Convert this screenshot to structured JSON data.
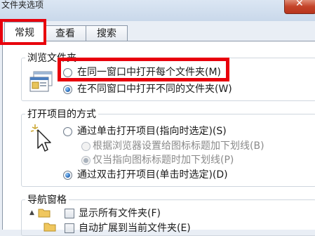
{
  "window": {
    "title": "文件夹选项",
    "close_symbol": "✕"
  },
  "tabs": [
    {
      "label": "常规",
      "active": true
    },
    {
      "label": "查看",
      "active": false
    },
    {
      "label": "搜索",
      "active": false
    }
  ],
  "browse_folders": {
    "title": "浏览文件夹",
    "options": [
      {
        "label": "在同一窗口中打开每个文件夹(M)",
        "checked": false
      },
      {
        "label": "在不同窗口中打开不同的文件夹(W)",
        "checked": true
      }
    ]
  },
  "open_items": {
    "title": "打开项目的方式",
    "options": [
      {
        "label": "通过单击打开项目(指向时选定)(S)",
        "checked": false,
        "disabled": false
      },
      {
        "label": "根据浏览器设置给图标标题加下划线(B)",
        "checked": false,
        "disabled": true
      },
      {
        "label": "仅当指向图标标题时加下划线(P)",
        "checked": true,
        "disabled": true
      },
      {
        "label": "通过双击打开项目(单击时选定)(D)",
        "checked": true,
        "disabled": false
      }
    ]
  },
  "navigation_pane": {
    "title": "导航窗格",
    "options": [
      {
        "label": "显示所有文件夹(F)",
        "checked": false
      },
      {
        "label": "自动扩展到当前文件夹(E)",
        "checked": false
      }
    ]
  },
  "colors": {
    "highlight": "#e8000c",
    "accent": "#1b5fb0"
  }
}
